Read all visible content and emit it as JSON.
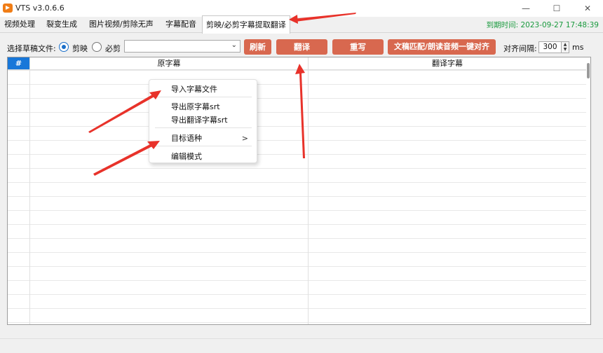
{
  "window": {
    "title": "VTS v3.0.6.6",
    "minimize_glyph": "—",
    "maximize_glyph": "☐",
    "close_glyph": "✕"
  },
  "tabs": [
    {
      "label": "视频处理"
    },
    {
      "label": "裂变生成"
    },
    {
      "label": "图片视频/剪除无声"
    },
    {
      "label": "字幕配音"
    },
    {
      "label": "剪映/必剪字幕提取翻译",
      "active": true
    }
  ],
  "expiry": "到期时间: 2023-09-27 17:48:39",
  "toolbar": {
    "select_draft_label": "选择草稿文件:",
    "radio_jianying": "剪映",
    "radio_bijian": "必剪",
    "draft_value": "",
    "refresh_label": "刷新",
    "translate_label": "翻译",
    "rewrite_label": "重写",
    "match_label": "文稿匹配/朗读音频一键对齐",
    "interval_label": "对齐间隔:",
    "interval_value": "300",
    "interval_unit": "ms"
  },
  "grid": {
    "headers": [
      "#",
      "原字幕",
      "翻译字幕"
    ]
  },
  "context_menu": {
    "items": [
      "导入字幕文件",
      "导出原字幕srt",
      "导出翻译字幕srt",
      "目标语种",
      "编辑模式"
    ],
    "submenu_arrow": ">"
  },
  "colors": {
    "accent_button": "#d8684f",
    "header_blue": "#1877d9",
    "expiry_green": "#1a9a3e",
    "annotation_red": "#e8322a"
  }
}
